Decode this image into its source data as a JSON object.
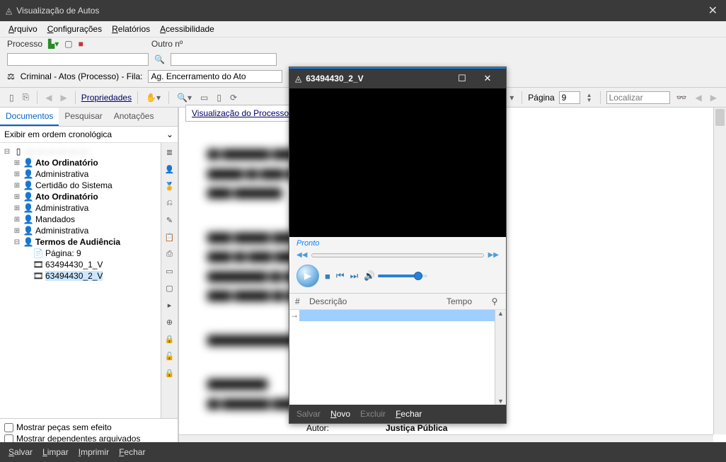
{
  "window": {
    "title": "Visualização de Autos"
  },
  "menubar": {
    "arquivo": "Arquivo",
    "config": "Configurações",
    "relatorios": "Relatórios",
    "acess": "Acessibilidade"
  },
  "row2": {
    "processo": "Processo",
    "outro": "Outro nº"
  },
  "row3": {
    "prefix": "Criminal - Atos (Processo) - Fila:",
    "fila": "Ag. Encerramento do Ato"
  },
  "toolbar2": {
    "propriedades": "Propriedades",
    "pagina": "Página",
    "pagina_val": "9",
    "localizar": "Localizar"
  },
  "tabs": {
    "documentos": "Documentos",
    "pesquisar": "Pesquisar",
    "anotacoes": "Anotações"
  },
  "order": "Exibir em ordem cronológica",
  "tree": {
    "n1": "Ato Ordinatório",
    "n2": "Administrativa",
    "n3": "Certidão do Sistema",
    "n4": "Ato Ordinatório",
    "n5": "Administrativa",
    "n6": "Mandados",
    "n7": "Administrativa",
    "n8": "Termos de Audiência",
    "p1": "Página: 9",
    "f1": "63494430_1_V",
    "f2": "63494430_2_V"
  },
  "checks": {
    "c1": "Mostrar peças sem efeito",
    "c2": "Mostrar dependentes arquivados"
  },
  "proctab": "Visualização do Processo",
  "statusbar": {
    "salvar": "Salvar",
    "limpar": "Limpar",
    "imprimir": "Imprimir",
    "fechar": "Fechar"
  },
  "media": {
    "title": "63494430_2_V",
    "status": "Pronto",
    "cols": {
      "num": "#",
      "desc": "Descrição",
      "tempo": "Tempo"
    },
    "bar": {
      "salvar": "Salvar",
      "novo": "Novo",
      "excluir": "Excluir",
      "fechar": "Fechar"
    }
  },
  "doc": {
    "autor": "Autor:",
    "jp": "Justiça Pública"
  }
}
